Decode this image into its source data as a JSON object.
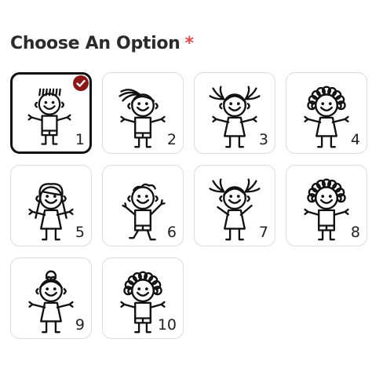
{
  "form": {
    "title": "Choose An Option",
    "required_marker": "*",
    "selected_index": 0,
    "options": [
      {
        "label": "1",
        "figure": "boy-spiky-hair",
        "selected": true
      },
      {
        "label": "2",
        "figure": "girl-ponytail",
        "selected": false
      },
      {
        "label": "3",
        "figure": "girl-pigtails-dress",
        "selected": false
      },
      {
        "label": "4",
        "figure": "girl-curly-hair-dress",
        "selected": false
      },
      {
        "label": "5",
        "figure": "girl-long-hair",
        "selected": false
      },
      {
        "label": "6",
        "figure": "boy-jumping",
        "selected": false
      },
      {
        "label": "7",
        "figure": "girl-pigtails-jumping",
        "selected": false
      },
      {
        "label": "8",
        "figure": "boy-curly-hair",
        "selected": false
      },
      {
        "label": "9",
        "figure": "girl-bun-dress",
        "selected": false
      },
      {
        "label": "10",
        "figure": "boy-big-head-curly",
        "selected": false
      }
    ]
  },
  "colors": {
    "required": "#e04a4a",
    "check_badge": "#8b1717",
    "selected_border": "#111111",
    "tile_border": "#dcdcdc"
  },
  "icons": {
    "check": "check-icon"
  }
}
